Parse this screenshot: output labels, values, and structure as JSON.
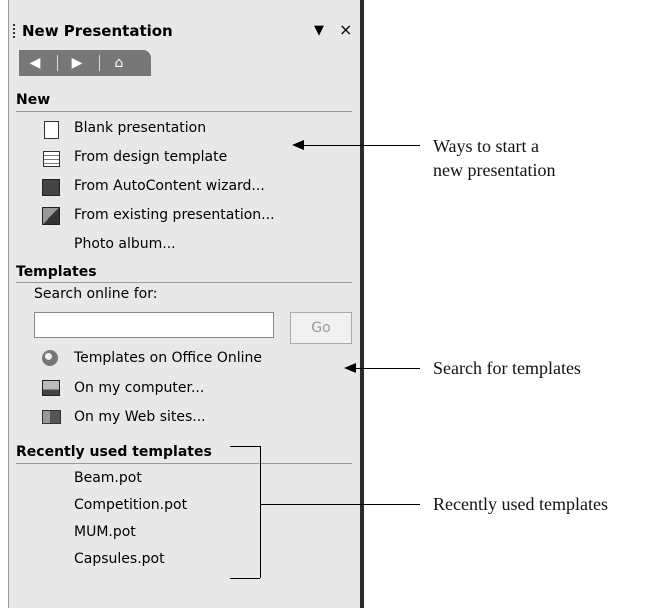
{
  "pane": {
    "title": "New Presentation",
    "dropdown_glyph": "▼",
    "close_glyph": "×",
    "nav": {
      "back_glyph": "◀",
      "forward_glyph": "▶",
      "home_glyph": "⌂"
    }
  },
  "sections": {
    "new": {
      "heading": "New",
      "items": [
        {
          "label": "Blank presentation",
          "icon": "blank-presentation-icon"
        },
        {
          "label": "From design template",
          "icon": "design-template-icon"
        },
        {
          "label": "From AutoContent wizard...",
          "icon": "autocontent-wizard-icon"
        },
        {
          "label": "From existing presentation...",
          "icon": "existing-presentation-icon"
        },
        {
          "label": "Photo album...",
          "icon": ""
        }
      ]
    },
    "templates": {
      "heading": "Templates",
      "search_label": "Search online for:",
      "search_value": "",
      "go_label": "Go",
      "items": [
        {
          "label": "Templates on Office Online",
          "icon": "office-online-icon"
        },
        {
          "label": "On my computer...",
          "icon": "my-computer-icon"
        },
        {
          "label": "On my Web sites...",
          "icon": "web-sites-icon"
        }
      ]
    },
    "recent": {
      "heading": "Recently used templates",
      "items": [
        "Beam.pot",
        "Competition.pot",
        "MUM.pot",
        "Capsules.pot"
      ]
    }
  },
  "callouts": {
    "new_line1": "Ways to start a",
    "new_line2": "new presentation",
    "search": "Search for templates",
    "recent": "Recently used templates"
  }
}
